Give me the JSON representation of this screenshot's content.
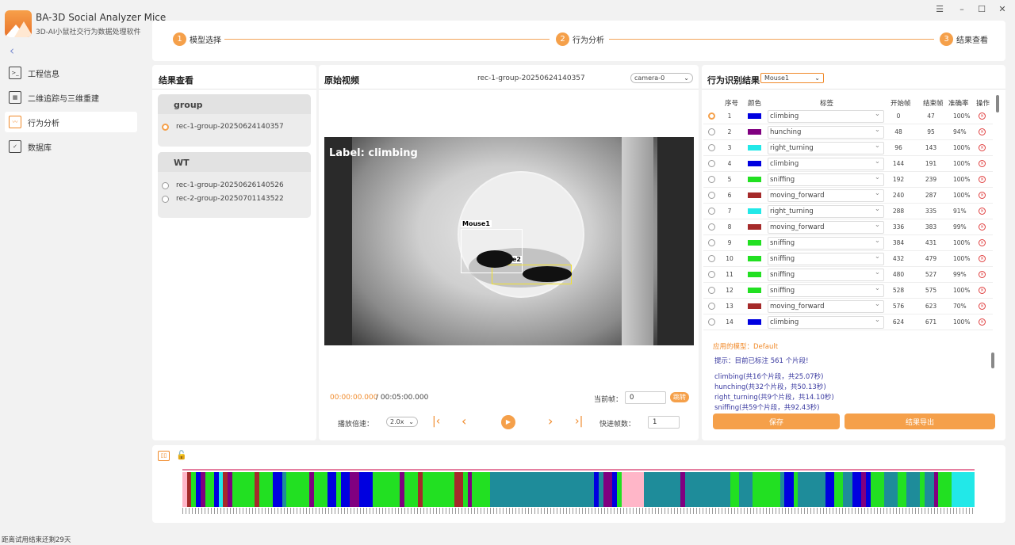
{
  "app": {
    "title": "BA-3D Social Analyzer Mice",
    "subtitle": "3D-AI小鼠社交行为数据处理软件",
    "icon": "app-logo"
  },
  "window_controls": [
    "menu-icon",
    "minimize-icon",
    "maximize-icon",
    "close-icon"
  ],
  "sidebar": {
    "items": [
      {
        "label": "工程信息",
        "icon": "terminal-icon"
      },
      {
        "label": "二维追踪与三维重建",
        "icon": "calendar-icon"
      },
      {
        "label": "行为分析",
        "icon": "chart-icon",
        "active": true
      },
      {
        "label": "数据库",
        "icon": "checklist-icon"
      }
    ]
  },
  "steps": [
    {
      "num": "1",
      "label": "模型选择"
    },
    {
      "num": "2",
      "label": "行为分析"
    },
    {
      "num": "3",
      "label": "结果查看"
    }
  ],
  "results_panel": {
    "title": "结果查看",
    "groups": [
      {
        "name": "group",
        "recs": [
          {
            "label": "rec-1-group-20250624140357",
            "selected": true
          }
        ]
      },
      {
        "name": "WT",
        "recs": [
          {
            "label": "rec-1-group-20250626140526",
            "selected": false
          },
          {
            "label": "rec-2-group-20250701143522",
            "selected": false
          }
        ]
      }
    ]
  },
  "video": {
    "title": "原始视频",
    "file": "rec-1-group-20250624140357",
    "camera": "camera-0",
    "overlay_label": "Label: climbing",
    "mouse1": "Mouse1",
    "mouse2": "Mouse2",
    "time_current": "00:00:00.000",
    "time_total": "/ 00:05:00.000",
    "current_frame_label": "当前帧：",
    "current_frame_value": "0",
    "jump_label": "跳转",
    "speed_label": "播放倍速：",
    "speed_value": "2.0x",
    "ff_label": "快进帧数：",
    "ff_value": "1"
  },
  "behavior": {
    "title": "行为识别结果",
    "mouse_select": "Mouse1",
    "headers": [
      "序号",
      "颜色",
      "标签",
      "开始帧",
      "结束帧",
      "准确率",
      "操作"
    ],
    "rows": [
      {
        "n": "1",
        "color": "#0000e0",
        "label": "climbing",
        "start": "0",
        "end": "47",
        "acc": "100%",
        "selected": true
      },
      {
        "n": "2",
        "color": "#800080",
        "label": "hunching",
        "start": "48",
        "end": "95",
        "acc": "94%"
      },
      {
        "n": "3",
        "color": "#22e8e8",
        "label": "right_turning",
        "start": "96",
        "end": "143",
        "acc": "100%"
      },
      {
        "n": "4",
        "color": "#0000e0",
        "label": "climbing",
        "start": "144",
        "end": "191",
        "acc": "100%"
      },
      {
        "n": "5",
        "color": "#22e022",
        "label": "sniffing",
        "start": "192",
        "end": "239",
        "acc": "100%"
      },
      {
        "n": "6",
        "color": "#a52a2a",
        "label": "moving_forward",
        "start": "240",
        "end": "287",
        "acc": "100%"
      },
      {
        "n": "7",
        "color": "#22e8e8",
        "label": "right_turning",
        "start": "288",
        "end": "335",
        "acc": "91%"
      },
      {
        "n": "8",
        "color": "#a52a2a",
        "label": "moving_forward",
        "start": "336",
        "end": "383",
        "acc": "99%"
      },
      {
        "n": "9",
        "color": "#22e022",
        "label": "sniffing",
        "start": "384",
        "end": "431",
        "acc": "100%"
      },
      {
        "n": "10",
        "color": "#22e022",
        "label": "sniffing",
        "start": "432",
        "end": "479",
        "acc": "100%"
      },
      {
        "n": "11",
        "color": "#22e022",
        "label": "sniffing",
        "start": "480",
        "end": "527",
        "acc": "99%"
      },
      {
        "n": "12",
        "color": "#22e022",
        "label": "sniffing",
        "start": "528",
        "end": "575",
        "acc": "100%"
      },
      {
        "n": "13",
        "color": "#a52a2a",
        "label": "moving_forward",
        "start": "576",
        "end": "623",
        "acc": "70%"
      },
      {
        "n": "14",
        "color": "#0000e0",
        "label": "climbing",
        "start": "624",
        "end": "671",
        "acc": "100%"
      }
    ],
    "model_label": "应用的模型：Default",
    "hint": "提示：目前已标注 561 个片段!",
    "summary": [
      "climbing(共16个片段，共25.07秒)",
      "hunching(共32个片段，共50.13秒)",
      "right_turning(共9个片段，共14.10秒)",
      "sniffing(共59个片段，共92.43秒)"
    ],
    "save": "保存",
    "export": "结果导出"
  },
  "timeline": {
    "colors": [
      "#0000e0",
      "#800080",
      "#22e8e8",
      "#22e022",
      "#a52a2a",
      "#1e8c9a",
      "#ffb6c8"
    ],
    "segments": [
      6,
      4,
      3,
      0,
      1,
      3,
      3,
      0,
      2,
      4,
      1,
      3,
      3,
      3,
      3,
      3,
      4,
      3,
      3,
      3,
      0,
      0,
      5,
      3,
      3,
      3,
      3,
      3,
      1,
      3,
      3,
      3,
      0,
      0,
      3,
      0,
      0,
      1,
      1,
      0,
      0,
      0,
      3,
      3,
      3,
      3,
      3,
      3,
      1,
      3,
      3,
      3,
      4,
      3,
      3,
      3,
      3,
      3,
      3,
      3,
      4,
      4,
      3,
      1,
      3,
      3,
      3,
      3,
      5,
      5,
      5,
      5,
      5,
      5,
      5,
      5,
      5,
      5,
      5,
      5,
      5,
      5,
      5,
      5,
      5,
      5,
      5,
      5,
      5,
      5,
      5,
      0,
      5,
      1,
      1,
      0,
      3,
      6,
      6,
      6,
      6,
      6,
      5,
      5,
      5,
      5,
      5,
      5,
      5,
      5,
      1,
      5,
      5,
      5,
      5,
      5,
      5,
      5,
      5,
      5,
      5,
      3,
      3,
      5,
      5,
      5,
      3,
      3,
      3,
      3,
      3,
      3,
      5,
      0,
      0,
      3,
      5,
      5,
      5,
      5,
      5,
      5,
      0,
      0,
      3,
      3,
      5,
      5,
      0,
      0,
      1,
      0,
      3,
      3,
      3,
      5,
      5,
      5,
      3,
      3,
      5,
      5,
      5,
      3,
      5,
      5,
      1,
      3,
      3,
      3,
      2,
      2,
      2,
      2,
      2
    ]
  },
  "status": "距离试用结束还剩29天"
}
